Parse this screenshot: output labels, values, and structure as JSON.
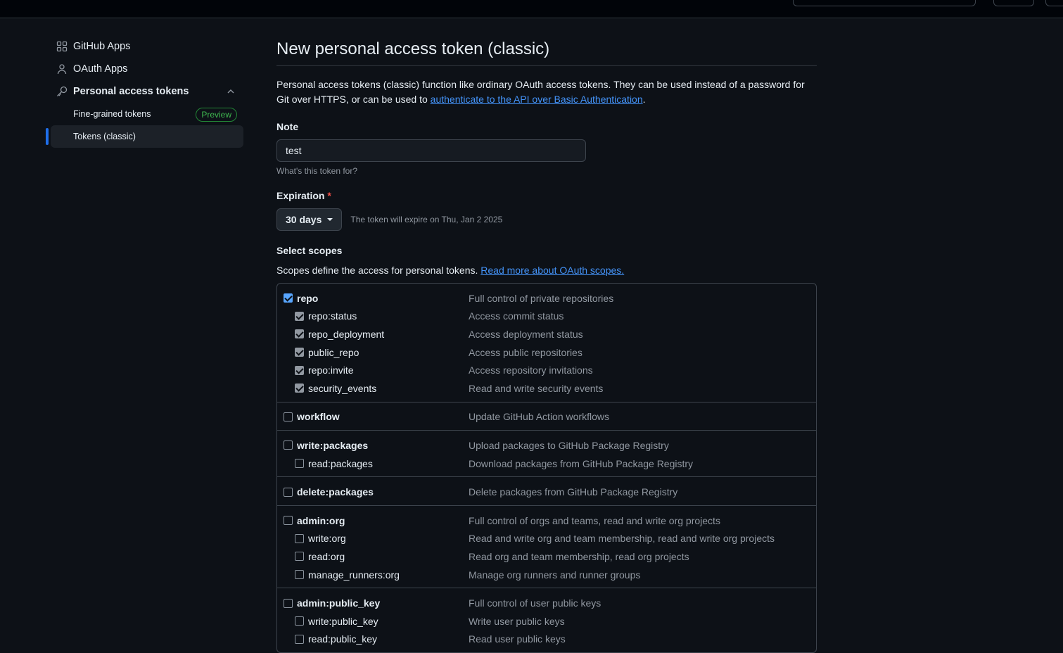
{
  "sidebar": {
    "items": [
      {
        "label": "GitHub Apps"
      },
      {
        "label": "OAuth Apps"
      },
      {
        "label": "Personal access tokens"
      }
    ],
    "subitems": [
      {
        "label": "Fine-grained tokens",
        "badge": "Preview"
      },
      {
        "label": "Tokens (classic)"
      }
    ]
  },
  "main": {
    "title": "New personal access token (classic)",
    "intro_text": "Personal access tokens (classic) function like ordinary OAuth access tokens. They can be used instead of a password for Git over HTTPS, or can be used to ",
    "intro_link": "authenticate to the API over Basic Authentication",
    "intro_end": ".",
    "note_label": "Note",
    "note_value": "test",
    "note_hint": "What's this token for?",
    "expiration_label": "Expiration",
    "expiration_required": "*",
    "expiration_value": "30 days",
    "expiration_note": "The token will expire on Thu, Jan 2 2025",
    "scopes_label": "Select scopes",
    "scopes_desc": "Scopes define the access for personal tokens. ",
    "scopes_link": "Read more about OAuth scopes."
  },
  "scopes": [
    {
      "name": "repo",
      "desc": "Full control of private repositories",
      "checked": true,
      "children": [
        {
          "name": "repo:status",
          "desc": "Access commit status",
          "checked": true
        },
        {
          "name": "repo_deployment",
          "desc": "Access deployment status",
          "checked": true
        },
        {
          "name": "public_repo",
          "desc": "Access public repositories",
          "checked": true
        },
        {
          "name": "repo:invite",
          "desc": "Access repository invitations",
          "checked": true
        },
        {
          "name": "security_events",
          "desc": "Read and write security events",
          "checked": true
        }
      ]
    },
    {
      "name": "workflow",
      "desc": "Update GitHub Action workflows",
      "checked": false,
      "children": []
    },
    {
      "name": "write:packages",
      "desc": "Upload packages to GitHub Package Registry",
      "checked": false,
      "children": [
        {
          "name": "read:packages",
          "desc": "Download packages from GitHub Package Registry",
          "checked": false
        }
      ]
    },
    {
      "name": "delete:packages",
      "desc": "Delete packages from GitHub Package Registry",
      "checked": false,
      "children": []
    },
    {
      "name": "admin:org",
      "desc": "Full control of orgs and teams, read and write org projects",
      "checked": false,
      "children": [
        {
          "name": "write:org",
          "desc": "Read and write org and team membership, read and write org projects",
          "checked": false
        },
        {
          "name": "read:org",
          "desc": "Read org and team membership, read org projects",
          "checked": false
        },
        {
          "name": "manage_runners:org",
          "desc": "Manage org runners and runner groups",
          "checked": false
        }
      ]
    },
    {
      "name": "admin:public_key",
      "desc": "Full control of user public keys",
      "checked": false,
      "children": [
        {
          "name": "write:public_key",
          "desc": "Write user public keys",
          "checked": false
        },
        {
          "name": "read:public_key",
          "desc": "Read user public keys",
          "checked": false
        }
      ]
    }
  ]
}
